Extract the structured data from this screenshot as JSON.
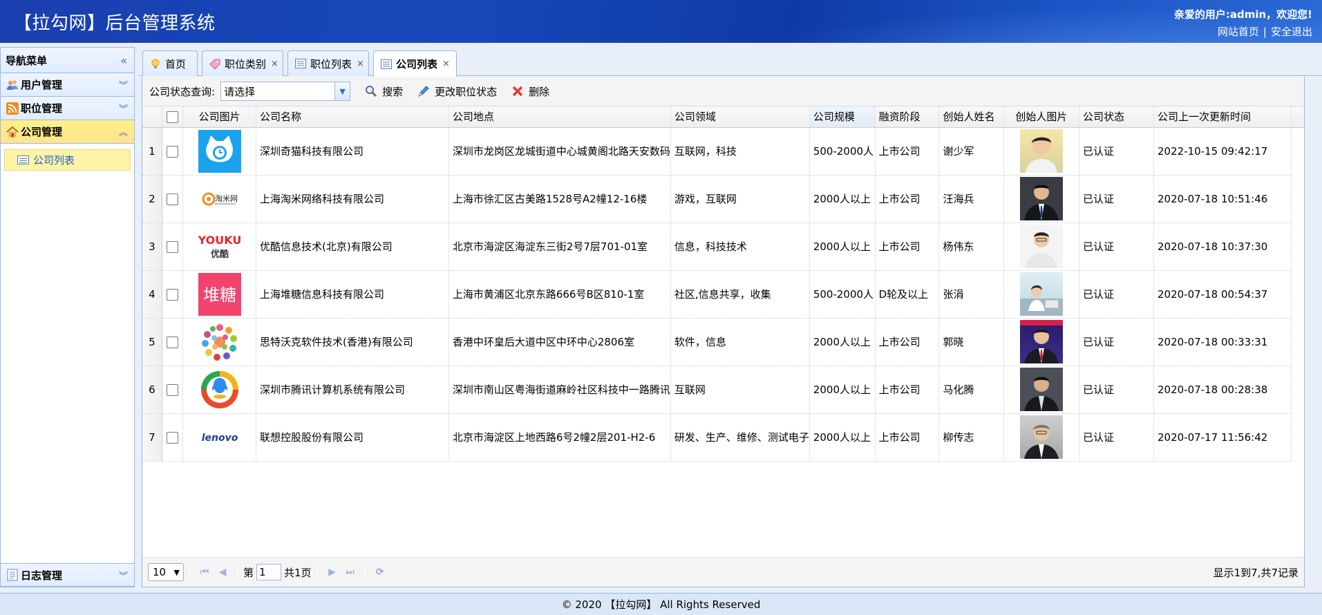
{
  "header": {
    "title": "【拉勾网】后台管理系统",
    "welcome": "亲爱的用户:admin，欢迎您!",
    "link_home": "网站首页",
    "link_sep": "|",
    "link_logout": "安全退出"
  },
  "nav": {
    "title": "导航菜单",
    "groups": [
      {
        "label": "用户管理",
        "icon": "users-icon"
      },
      {
        "label": "职位管理",
        "icon": "rss-icon"
      },
      {
        "label": "公司管理",
        "icon": "home-icon"
      }
    ],
    "company_items": [
      {
        "label": "公司列表",
        "icon": "table-icon"
      }
    ],
    "bottom_group": {
      "label": "日志管理",
      "icon": "log-icon"
    }
  },
  "tabs": [
    {
      "label": "首页",
      "icon": "lightbulb-icon"
    },
    {
      "label": "职位类别",
      "icon": "tag-icon"
    },
    {
      "label": "职位列表",
      "icon": "table-icon"
    },
    {
      "label": "公司列表",
      "icon": "table-icon"
    }
  ],
  "toolbar": {
    "query_label": "公司状态查询:",
    "select_value": "请选择",
    "search": "搜索",
    "change_status": "更改职位状态",
    "delete": "删除"
  },
  "table": {
    "headers": [
      "公司图片",
      "公司名称",
      "公司地点",
      "公司领域",
      "公司规模",
      "融资阶段",
      "创始人姓名",
      "创始人图片",
      "公司状态",
      "公司上一次更新时间"
    ],
    "rows": [
      {
        "n": "1",
        "name": "深圳奇猫科技有限公司",
        "addr": "深圳市龙岗区龙城街道中心城黄阁北路天安数码",
        "field": "互联网，科技",
        "size": "500-2000人",
        "stage": "上市公司",
        "founder": "谢少军",
        "status": "已认证",
        "time": "2022-10-15 09:42:17",
        "logo": "qimao-logo"
      },
      {
        "n": "2",
        "name": "上海淘米网络科技有限公司",
        "addr": "上海市徐汇区古美路1528号A2幢12-16楼",
        "field": "游戏，互联网",
        "size": "2000人以上",
        "stage": "上市公司",
        "founder": "汪海兵",
        "status": "已认证",
        "time": "2020-07-18 10:51:46",
        "logo": "taomi-logo",
        "logo_text": "淘米网"
      },
      {
        "n": "3",
        "name": "优酷信息技术(北京)有限公司",
        "addr": "北京市海淀区海淀东三街2号7层701-01室",
        "field": "信息，科技技术",
        "size": "2000人以上",
        "stage": "上市公司",
        "founder": "杨伟东",
        "status": "已认证",
        "time": "2020-07-18 10:37:30",
        "logo": "youku-logo",
        "logo_text": "YOUKU",
        "logo_text2": "优酷"
      },
      {
        "n": "4",
        "name": "上海堆糖信息科技有限公司",
        "addr": "上海市黄浦区北京东路666号B区810-1室",
        "field": "社区,信息共享，收集",
        "size": "500-2000人",
        "stage": "D轮及以上",
        "founder": "张涓",
        "status": "已认证",
        "time": "2020-07-18 00:54:37",
        "logo": "duitang-logo",
        "logo_text": "堆糖"
      },
      {
        "n": "5",
        "name": "思特沃克软件技术(香港)有限公司",
        "addr": "香港中环皇后大道中区中环中心2806室",
        "field": "软件，信息",
        "size": "2000人以上",
        "stage": "上市公司",
        "founder": "郭晓",
        "status": "已认证",
        "time": "2020-07-18 00:33:31",
        "logo": "thoughtworks-logo"
      },
      {
        "n": "6",
        "name": "深圳市腾讯计算机系统有限公司",
        "addr": "深圳市南山区粤海街道麻岭社区科技中一路腾讯",
        "field": "互联网",
        "size": "2000人以上",
        "stage": "上市公司",
        "founder": "马化腾",
        "status": "已认证",
        "time": "2020-07-18 00:28:38",
        "logo": "tencent-logo"
      },
      {
        "n": "7",
        "name": "联想控股股份有限公司",
        "addr": "北京市海淀区上地西路6号2幢2层201-H2-6",
        "field": "研发、生产、维修、测试电子",
        "size": "2000人以上",
        "stage": "上市公司",
        "founder": "柳传志",
        "status": "已认证",
        "time": "2020-07-17 11:56:42",
        "logo": "lenovo-logo",
        "logo_text": "lenovo"
      }
    ]
  },
  "pager": {
    "page_size": "10",
    "page_prefix": "第",
    "page_value": "1",
    "page_suffix": "共1页",
    "info": "显示1到7,共7记录"
  },
  "footer": {
    "text": "© 2020 【拉勾网】 All Rights Reserved"
  }
}
